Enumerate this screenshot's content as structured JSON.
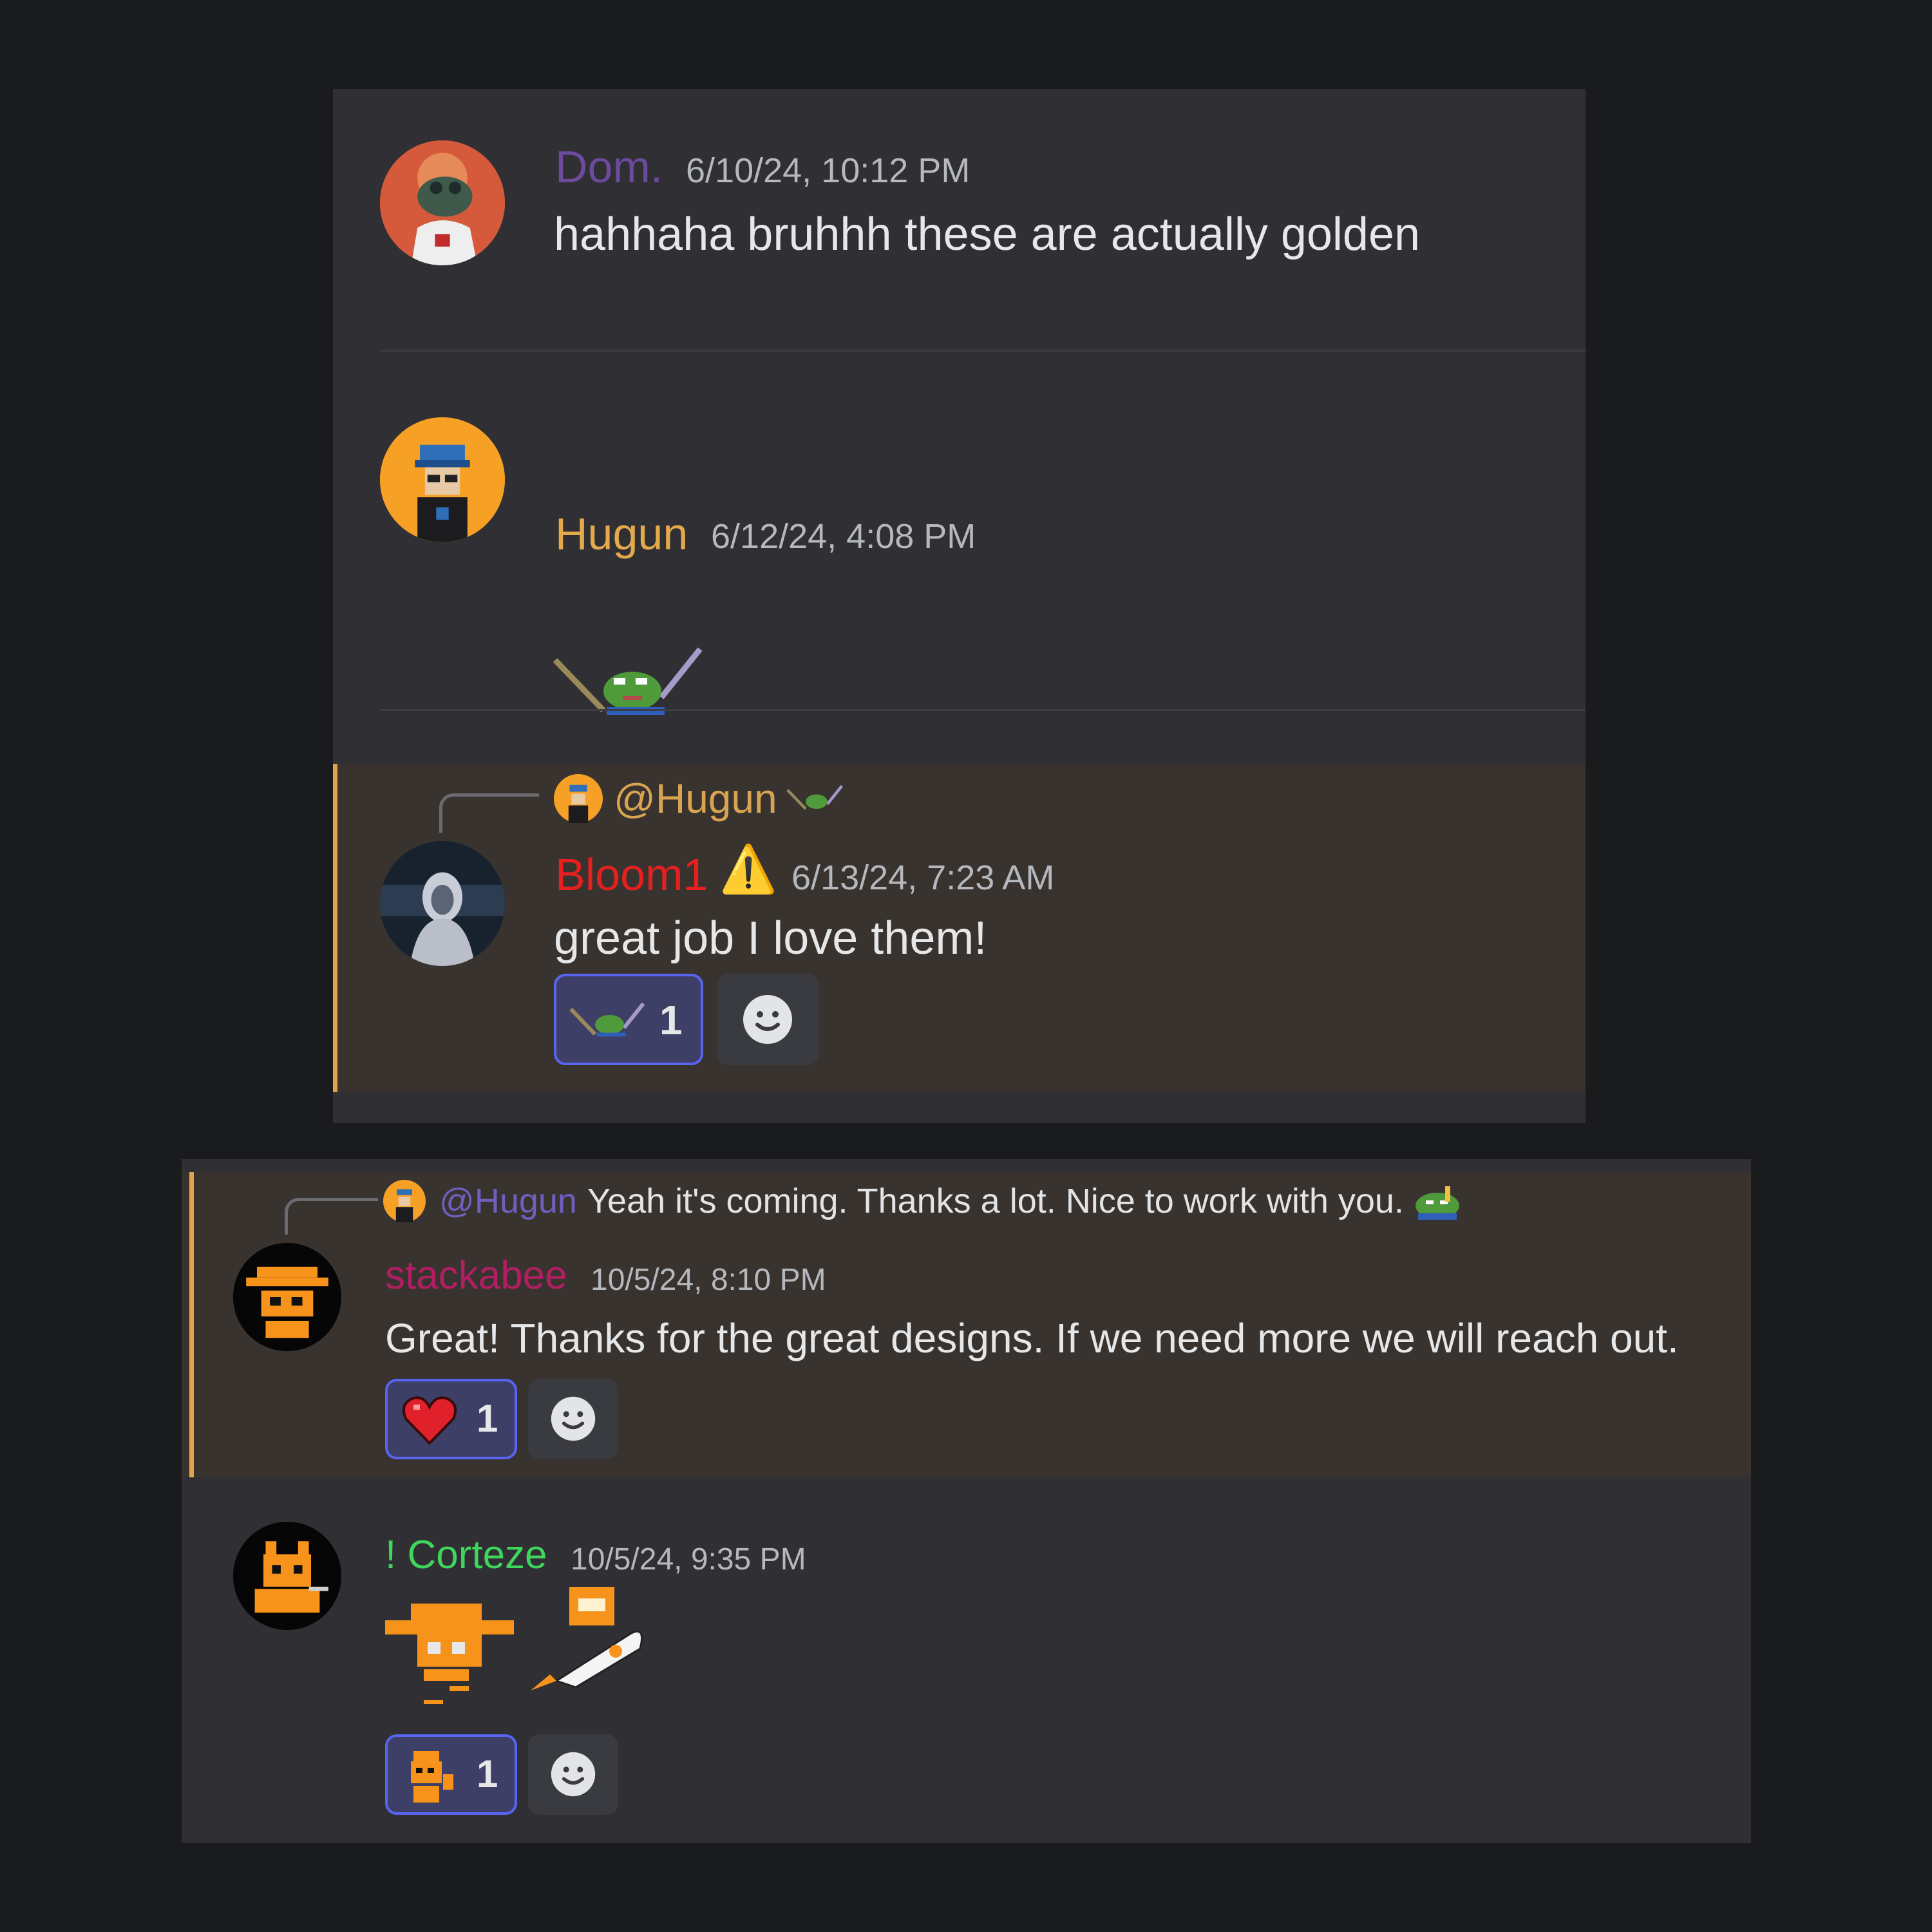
{
  "messages": [
    {
      "username": "Dom.",
      "timestamp": "6/10/24, 10:12 PM",
      "text": "hahhaha bruhhh these are actually golden",
      "name_color": "#6c4a9c"
    },
    {
      "username": "Hugun",
      "timestamp": "6/12/24, 4:08 PM",
      "text": "",
      "name_color": "#e3a94a",
      "attachment": "pepe-sword-emoji"
    },
    {
      "username": "Bloom1",
      "badge": "⚠️",
      "timestamp": "6/13/24, 7:23 AM",
      "text": "great job I love them!",
      "name_color": "#e61f1f",
      "reply": {
        "mention": "@Hugun",
        "preview_emoji": "pepe-sword-emoji"
      },
      "reactions": [
        {
          "emoji": "pepe-sword-emoji",
          "count": "1"
        }
      ]
    },
    {
      "username": "stackabee",
      "timestamp": "10/5/24, 8:10 PM",
      "text": "Great! Thanks for the great designs. If we need more we will reach out.",
      "name_color": "#b31e63",
      "reply": {
        "mention": "@Hugun",
        "preview_text": "Yeah it's coming. Thanks a lot. Nice to work with you.",
        "preview_emoji": "pepe-pointing-emoji"
      },
      "reactions": [
        {
          "emoji": "heart-emoji",
          "count": "1"
        }
      ]
    },
    {
      "username": "! Corteze",
      "timestamp": "10/5/24, 9:35 PM",
      "text": "",
      "name_color": "#3fd65c",
      "attachments": [
        "hat-character-emoji",
        "rocket-character-emoji"
      ],
      "reactions": [
        {
          "emoji": "character-wave-emoji",
          "count": "1"
        }
      ]
    }
  ],
  "colors": {
    "background": "#1a1b1c",
    "panel": "#2f2f34",
    "highlight": "#38332f",
    "highlight_bar": "#e2a44a",
    "reaction_border": "#5865f2"
  }
}
